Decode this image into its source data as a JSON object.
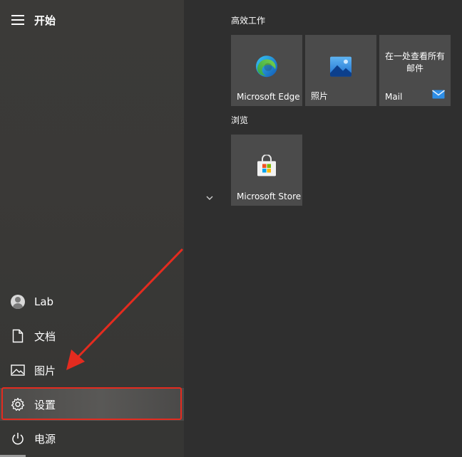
{
  "start_menu": {
    "title": "开始",
    "nav": {
      "user": "Lab",
      "documents": "文档",
      "pictures": "图片",
      "settings": "设置",
      "power": "电源"
    }
  },
  "groups": [
    {
      "title": "高效工作",
      "tiles": [
        {
          "label": "Microsoft Edge",
          "icon": "edge-icon"
        },
        {
          "label": "照片",
          "icon": "photos-icon"
        },
        {
          "label": "Mail",
          "text": "在一处查看所有邮件",
          "icon": "mail-icon"
        }
      ]
    },
    {
      "title": "浏览",
      "tiles": [
        {
          "label": "Microsoft Store",
          "icon": "store-icon"
        }
      ]
    }
  ],
  "colors": {
    "highlight": "#e42b1f",
    "tile_bg": "#4b4b4b",
    "pane_bg": "#2f2f2f"
  }
}
